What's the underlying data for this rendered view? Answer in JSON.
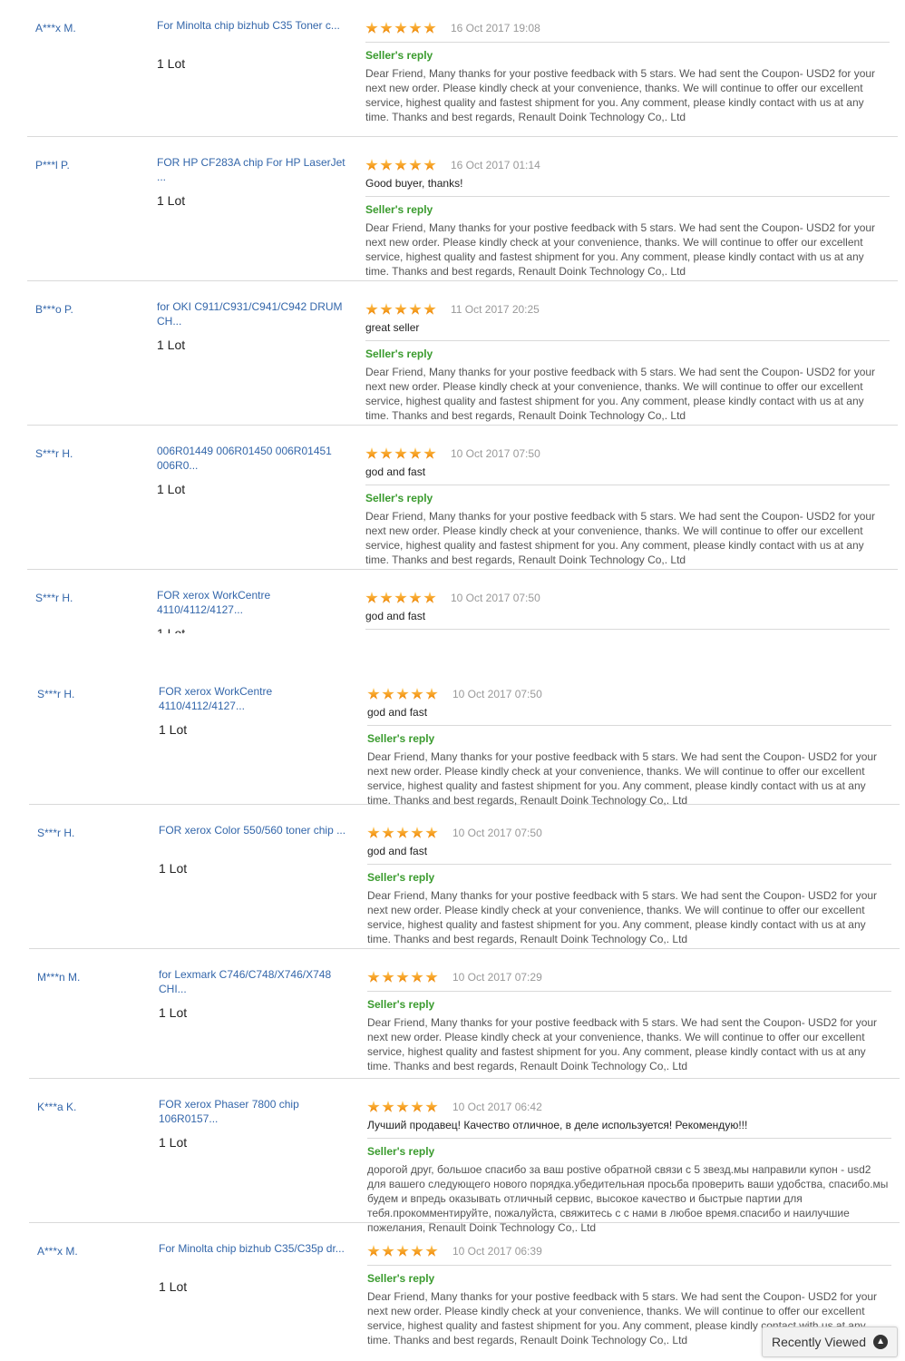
{
  "reply_label": "Seller's reply",
  "qty_label": "1 Lot",
  "reply_en": "Dear Friend, Many thanks for your postive feedback with 5 stars. We had sent the Coupon- USD2 for your next new order. Please kindly check at your convenience, thanks. We will continue to offer our excellent service, highest quality and fastest shipment for you. Any comment, please kindly contact with us at any time. Thanks and best regards, Renault Doink Technology Co,. Ltd",
  "reply_ru": "дорогой друг, большое спасибо за ваш postive обратной связи с 5 звезд.мы направили купон - usd2 для вашего следующего нового порядка.убедительная просьба проверить ваши удобства, спасибо.мы будем и впредь оказывать отличный сервис, высокое качество и быстрые партии для тебя.прокомментируйте, пожалуйста, свяжитесь с с нами в любое время.спасибо и наилучшие пожелания, Renault Doink Technology Co,. Ltd",
  "reviews_top": [
    {
      "buyer": "A***x M.",
      "product": "For Minolta chip bizhub C35 Toner c...",
      "date": "16 Oct 2017 19:08",
      "comment": "",
      "reply": "en"
    },
    {
      "buyer": "P***l P.",
      "product": "FOR HP CF283A chip For HP LaserJet ...",
      "date": "16 Oct 2017 01:14",
      "comment": "Good buyer, thanks!",
      "reply": "en"
    },
    {
      "buyer": "B***o P.",
      "product": "for OKI C911/C931/C941/C942 DRUM CH...",
      "date": "11 Oct 2017 20:25",
      "comment": "great seller",
      "reply": "en"
    },
    {
      "buyer": "S***r H.",
      "product": "006R01449 006R01450 006R01451 006R0...",
      "date": "10 Oct 2017 07:50",
      "comment": "god and fast",
      "reply": "en"
    },
    {
      "buyer": "S***r H.",
      "product": "FOR xerox WorkCentre 4110/4112/4127...",
      "date": "10 Oct 2017 07:50",
      "comment": "god and fast",
      "reply": "en"
    }
  ],
  "reviews_bottom": [
    {
      "buyer": "S***r H.",
      "product": "FOR xerox WorkCentre 4110/4112/4127...",
      "date": "10 Oct 2017 07:50",
      "comment": "god and fast",
      "reply": "en"
    },
    {
      "buyer": "S***r H.",
      "product": "FOR xerox Color 550/560 toner chip ...",
      "date": "10 Oct 2017 07:50",
      "comment": "god and fast",
      "reply": "en"
    },
    {
      "buyer": "M***n M.",
      "product": "for Lexmark C746/C748/X746/X748 CHI...",
      "date": "10 Oct 2017 07:29",
      "comment": "",
      "reply": "en"
    },
    {
      "buyer": "K***a K.",
      "product": "FOR xerox Phaser 7800 chip 106R0157...",
      "date": "10 Oct 2017 06:42",
      "comment": "Лучший продавец! Качество отличное, в деле используется! Рекомендую!!!",
      "reply": "ru"
    },
    {
      "buyer": "A***x M.",
      "product": "For Minolta chip bizhub C35/C35p dr...",
      "date": "10 Oct 2017 06:39",
      "comment": "",
      "reply": "en"
    }
  ],
  "recently_viewed": {
    "label": "Recently Viewed",
    "icon": "chevron-up-icon"
  }
}
